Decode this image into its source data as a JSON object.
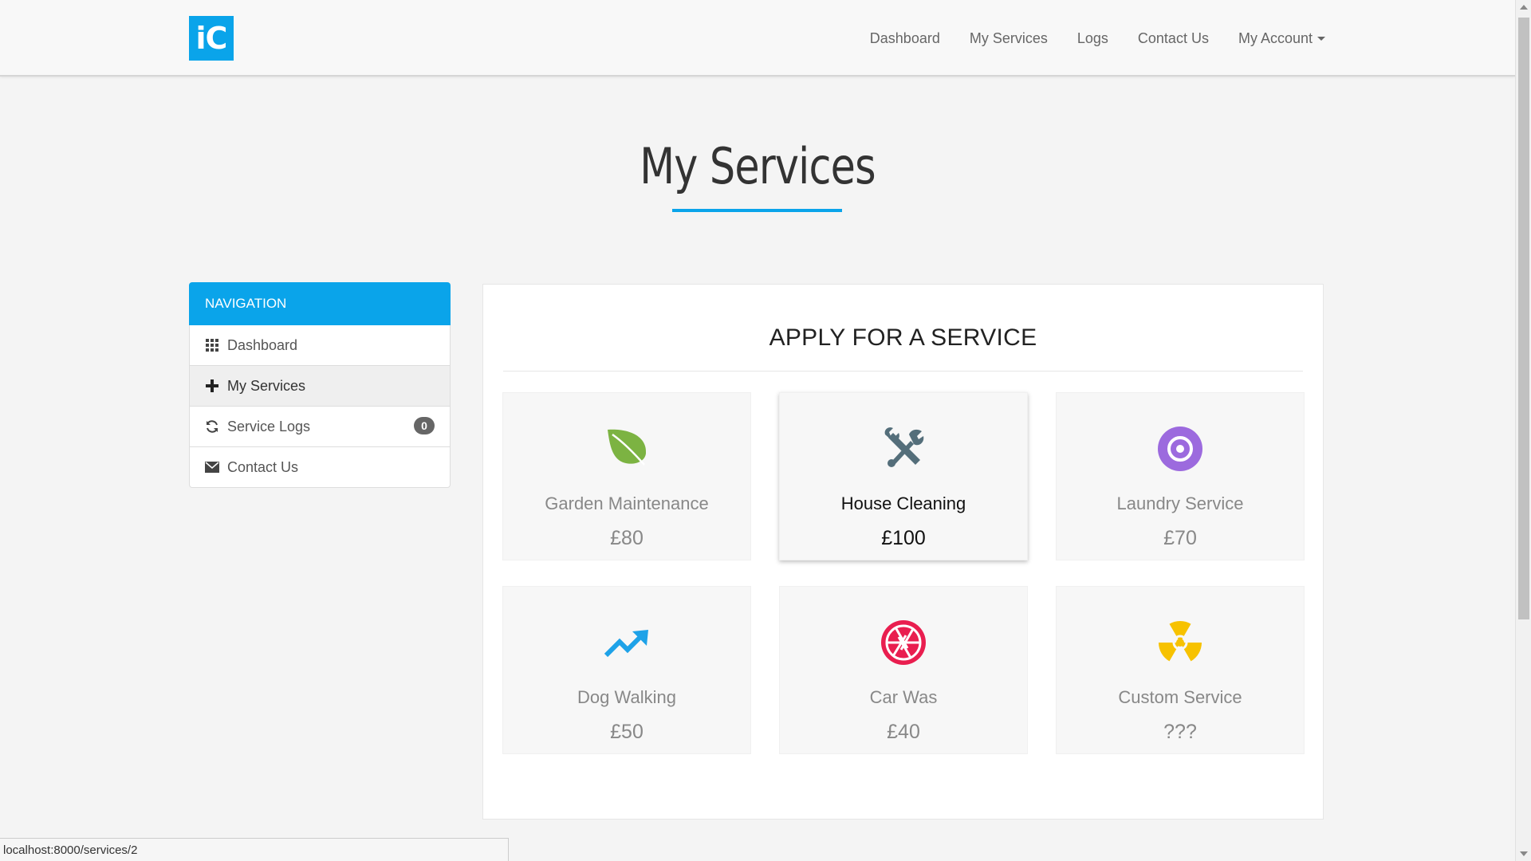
{
  "brand": {
    "logo_text": "iC",
    "color": "#0aa4ea"
  },
  "topnav": {
    "links": [
      "Dashboard",
      "My Services",
      "Logs",
      "Contact Us"
    ],
    "account_label": "My Account"
  },
  "page": {
    "title": "My Services"
  },
  "sidebar": {
    "heading": "NAVIGATION",
    "items": [
      {
        "label": "Dashboard",
        "icon": "grid-icon"
      },
      {
        "label": "My Services",
        "icon": "plus-icon",
        "active": true
      },
      {
        "label": "Service Logs",
        "icon": "refresh-icon",
        "badge": "0"
      },
      {
        "label": "Contact Us",
        "icon": "envelope-icon"
      }
    ]
  },
  "main": {
    "title": "APPLY FOR A SERVICE",
    "services": [
      {
        "name": "Garden Maintenance",
        "price": "£80",
        "icon": "leaf-icon",
        "color": "#7cb342"
      },
      {
        "name": "House Cleaning",
        "price": "£100",
        "icon": "tools-icon",
        "color": "#546e7a"
      },
      {
        "name": "Laundry Service",
        "price": "£70",
        "icon": "target-icon",
        "color": "#9c6ade"
      },
      {
        "name": "Dog Walking",
        "price": "£50",
        "icon": "trending-up-icon",
        "color": "#1ea2e8"
      },
      {
        "name": "Car Was",
        "price": "£40",
        "icon": "aperture-icon",
        "color": "#e91e4f"
      },
      {
        "name": "Custom Service",
        "price": "???",
        "icon": "radiation-icon",
        "color": "#f7c200"
      }
    ]
  },
  "status_bar": {
    "url": "localhost:8000/services/2"
  }
}
